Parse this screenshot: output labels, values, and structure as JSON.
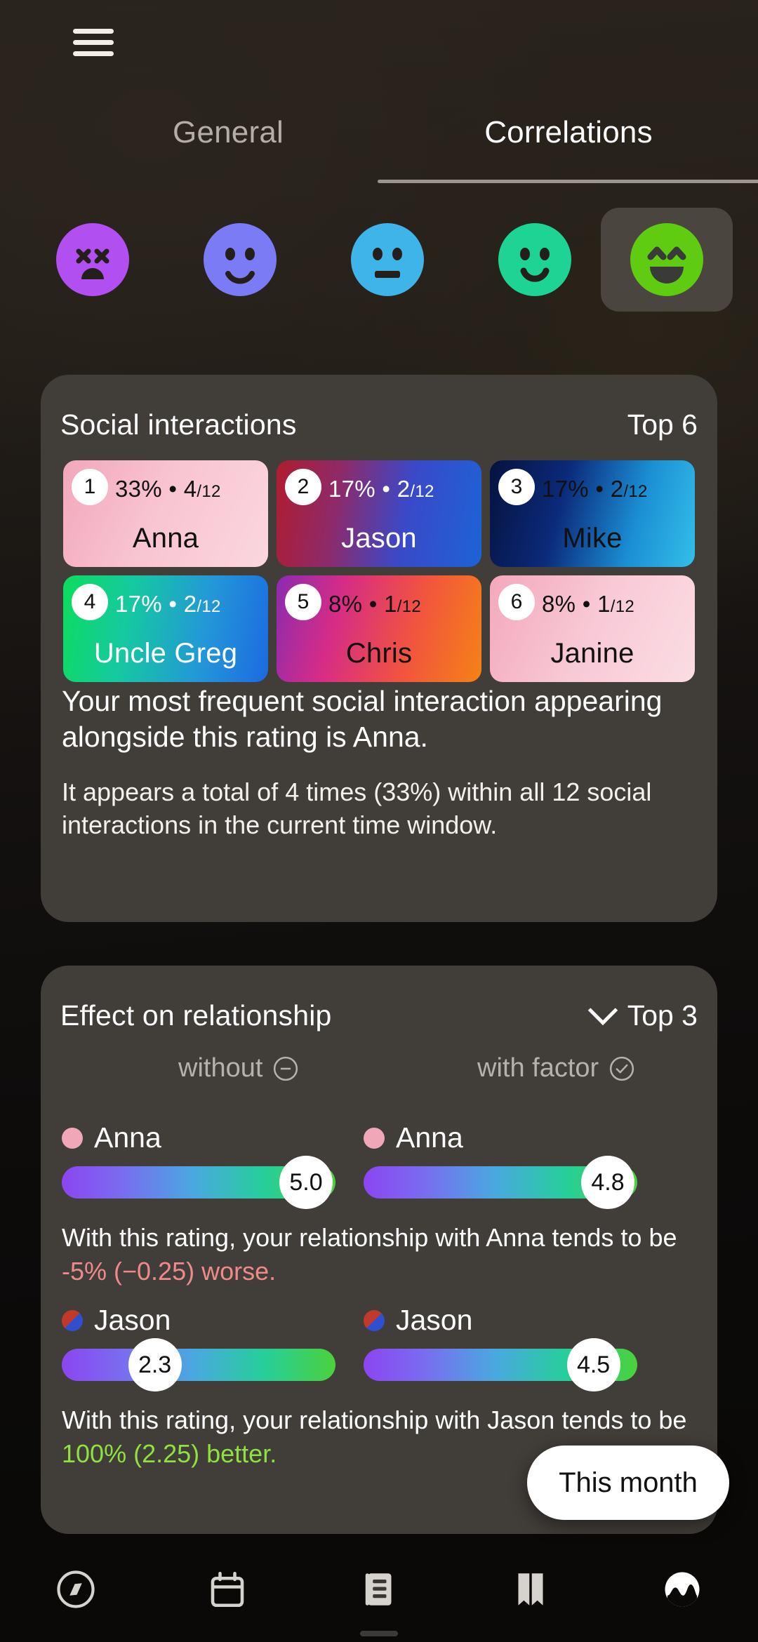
{
  "header": {
    "menu_icon": "hamburger-menu-icon",
    "tabs": [
      {
        "label": "General",
        "active": false
      },
      {
        "label": "Correlations",
        "active": true
      }
    ]
  },
  "mood_selector": {
    "options": [
      {
        "name": "mood-terrible",
        "icon": "dizzy-face-icon",
        "color": "#b14ff0",
        "selected": false
      },
      {
        "name": "mood-bad",
        "icon": "sad-face-icon",
        "color": "#7b7cf5",
        "selected": false
      },
      {
        "name": "mood-neutral",
        "icon": "neutral-face-icon",
        "color": "#3eb4e8",
        "selected": false
      },
      {
        "name": "mood-good",
        "icon": "smile-face-icon",
        "color": "#1ed494",
        "selected": false
      },
      {
        "name": "mood-great",
        "icon": "grin-face-icon",
        "color": "#5fcc12",
        "selected": true
      }
    ],
    "selected_background": "#4b4540"
  },
  "social_card": {
    "title": "Social interactions",
    "top_label": "Top 6",
    "tiles": [
      {
        "rank": "1",
        "percent": "33%",
        "sep": "•",
        "count": "4",
        "denominator": "/12",
        "name": "Anna",
        "text_tone": "dark",
        "gradient": "linear-gradient(115deg, #f2a7bb 0%, #f8c4d1 45%, #fbd7df 100%)"
      },
      {
        "rank": "2",
        "percent": "17%",
        "sep": "•",
        "count": "2",
        "denominator": "/12",
        "name": "Jason",
        "text_tone": "light",
        "gradient": "linear-gradient(100deg, #b01c2e 0%, #8e2a6a 30%, #3a49c8 62%, #1d63d6 100%)"
      },
      {
        "rank": "3",
        "percent": "17%",
        "sep": "•",
        "count": "2",
        "denominator": "/12",
        "name": "Mike",
        "text_tone": "dark",
        "gradient": "linear-gradient(105deg, #06123f 0%, #0b2a7a 35%, #1b8fd4 70%, #33bfe8 100%)"
      },
      {
        "rank": "4",
        "percent": "17%",
        "sep": "•",
        "count": "2",
        "denominator": "/12",
        "name": "Uncle Greg",
        "text_tone": "light",
        "gradient": "linear-gradient(100deg, #0ddc5e 0%, #15c9a0 32%, #2397d8 68%, #1c6ae0 100%)"
      },
      {
        "rank": "5",
        "percent": "8%",
        "sep": "•",
        "count": "1",
        "denominator": "/12",
        "name": "Chris",
        "text_tone": "dark",
        "gradient": "linear-gradient(105deg, #8a2bb0 0%, #d62c86 30%, #f1543f 65%, #f58216 100%)"
      },
      {
        "rank": "6",
        "percent": "8%",
        "sep": "•",
        "count": "1",
        "denominator": "/12",
        "name": "Janine",
        "text_tone": "dark",
        "gradient": "linear-gradient(115deg, #f3a8bc 0%, #f8c9d6 50%, #fbdde4 100%)"
      }
    ],
    "lead_text": "Your most frequent social interaction appearing alongside this rating is Anna.",
    "sub_text": "It appears a total of 4 times (33%) within all 12 social interactions in the current time window."
  },
  "effect_card": {
    "title": "Effect on relationship",
    "top_label": "Top 3",
    "chevron_icon": "chevron-down-icon",
    "columns": [
      {
        "label": "without",
        "icon": "minus-circle-icon"
      },
      {
        "label": "with factor",
        "icon": "check-circle-icon"
      }
    ],
    "rows": [
      {
        "name": "Anna",
        "dot_color": "#f0a8b8",
        "without": {
          "value": "5.0",
          "fill_ratio": 0.93
        },
        "with": {
          "value": "4.8",
          "fill_ratio": 0.9
        },
        "text_prefix": "With this rating, your relationship with Anna tends to be ",
        "delta_text": "-5% (−0.25) worse.",
        "delta_tone": "negative"
      },
      {
        "name": "Jason",
        "dot_color": "#c0392b",
        "dot_gradient": "linear-gradient(135deg, #c0392b 0%, #c0392b 48%, #2f4fd0 52%, #2f4fd0 100%)",
        "without": {
          "value": "2.3",
          "fill_ratio": 0.34
        },
        "with": {
          "value": "4.5",
          "fill_ratio": 0.84
        },
        "text_prefix": "With this rating, your relationship with Jason tends to be ",
        "delta_text": "100% (2.25) better.",
        "delta_tone": "positive"
      }
    ]
  },
  "time_pill": {
    "label": "This month"
  },
  "bottom_nav": {
    "items": [
      {
        "name": "nav-explore",
        "icon": "compass-icon",
        "active": false
      },
      {
        "name": "nav-calendar",
        "icon": "calendar-icon",
        "active": false
      },
      {
        "name": "nav-entries",
        "icon": "document-icon",
        "active": false
      },
      {
        "name": "nav-library",
        "icon": "book-icon",
        "active": false
      },
      {
        "name": "nav-stats",
        "icon": "stats-icon",
        "active": true
      }
    ]
  },
  "colors": {
    "background": "#17130f",
    "card": "#413d39",
    "accent_positive": "#8fe040",
    "accent_negative": "#f08a8a"
  }
}
